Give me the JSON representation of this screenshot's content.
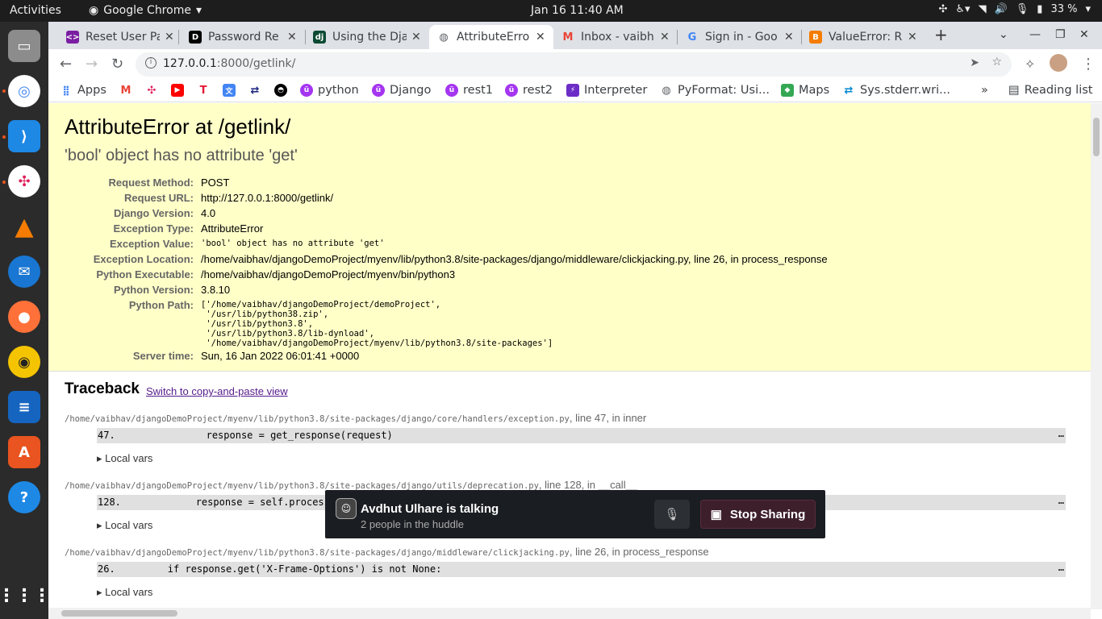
{
  "system": {
    "activities": "Activities",
    "app_name": "Google Chrome",
    "clock": "Jan 16  11:40 AM",
    "battery": "33 %"
  },
  "tabs": [
    {
      "title": "Reset User Pa",
      "icon": "code-arrows-icon",
      "color": "#7b1fa2"
    },
    {
      "title": "Password Re",
      "icon": "dev-icon",
      "color": "#000000"
    },
    {
      "title": "Using the Dja",
      "icon": "django-icon",
      "color": "#0c4b33"
    },
    {
      "title": "AttributeErro",
      "icon": "globe-icon",
      "color": "#5f6368"
    },
    {
      "title": "Inbox - vaibh",
      "icon": "gmail-icon",
      "color": "#ea4335"
    },
    {
      "title": "Sign in - Goo",
      "icon": "google-icon",
      "color": "#4285f4"
    },
    {
      "title": "ValueError: R",
      "icon": "blogger-icon",
      "color": "#f57c00"
    }
  ],
  "omnibox": {
    "host": "127.0.0.1",
    "path": ":8000/getlink/"
  },
  "bookmarks": [
    {
      "label": "Apps",
      "icon": "apps-grid-icon"
    },
    {
      "label": "",
      "icon": "gmail-icon"
    },
    {
      "label": "",
      "icon": "slack-icon"
    },
    {
      "label": "",
      "icon": "youtube-icon"
    },
    {
      "label": "",
      "icon": "tesla-icon"
    },
    {
      "label": "",
      "icon": "translate-icon"
    },
    {
      "label": "",
      "icon": "sync-icon"
    },
    {
      "label": "",
      "icon": "github-icon"
    },
    {
      "label": "python",
      "icon": "udemy-icon"
    },
    {
      "label": "Django",
      "icon": "udemy-icon"
    },
    {
      "label": "rest1",
      "icon": "udemy-icon"
    },
    {
      "label": "rest2",
      "icon": "udemy-icon"
    },
    {
      "label": "Interpreter",
      "icon": "bolt-icon"
    },
    {
      "label": "PyFormat: Usi...",
      "icon": "globe-icon"
    },
    {
      "label": "Maps",
      "icon": "maps-icon"
    },
    {
      "label": "Sys.stderr.wri...",
      "icon": "sync-icon"
    }
  ],
  "reading_list": "Reading list",
  "error": {
    "title": "AttributeError at /getlink/",
    "message": "'bool' object has no attribute 'get'",
    "meta": [
      {
        "key": "Request Method:",
        "value": "POST"
      },
      {
        "key": "Request URL:",
        "value": "http://127.0.0.1:8000/getlink/"
      },
      {
        "key": "Django Version:",
        "value": "4.0"
      },
      {
        "key": "Exception Type:",
        "value": "AttributeError"
      },
      {
        "key": "Exception Value:",
        "value": "'bool' object has no attribute 'get'"
      },
      {
        "key": "Exception Location:",
        "value": "/home/vaibhav/djangoDemoProject/myenv/lib/python3.8/site-packages/django/middleware/clickjacking.py, line 26, in process_response"
      },
      {
        "key": "Python Executable:",
        "value": "/home/vaibhav/djangoDemoProject/myenv/bin/python3"
      },
      {
        "key": "Python Version:",
        "value": "3.8.10"
      },
      {
        "key": "Python Path:",
        "value": "['/home/vaibhav/djangoDemoProject/demoProject',"
      },
      {
        "key": "Server time:",
        "value": "Sun, 16 Jan 2022 06:01:41 +0000"
      }
    ],
    "python_path_lines": [
      " '/usr/lib/python38.zip',",
      " '/usr/lib/python3.8',",
      " '/usr/lib/python3.8/lib-dynload',",
      " '/home/vaibhav/djangoDemoProject/myenv/lib/python3.8/site-packages']"
    ]
  },
  "traceback": {
    "heading": "Traceback",
    "switch_link": "Switch to copy-and-paste view",
    "frames": [
      {
        "path": "/home/vaibhav/djangoDemoProject/myenv/lib/python3.8/site-packages/django/core/handlers/exception.py",
        "suffix": ", line 47, in inner",
        "num": "47.",
        "code": "                response = get_response(request)",
        "local_vars": "Local vars"
      },
      {
        "path": "/home/vaibhav/djangoDemoProject/myenv/lib/python3.8/site-packages/django/utils/deprecation.py",
        "suffix": ", line 128, in __call__",
        "num": "128.",
        "code": "            response = self.process_response(request, response)",
        "local_vars": "Local vars"
      },
      {
        "path": "/home/vaibhav/djangoDemoProject/myenv/lib/python3.8/site-packages/django/middleware/clickjacking.py",
        "suffix": ", line 26, in process_response",
        "num": "26.",
        "code": "        if response.get('X-Frame-Options') is not None:",
        "local_vars": "Local vars"
      }
    ]
  },
  "huddle": {
    "name": "Avdhut Ulhare is talking",
    "sub": "2 people in the huddle",
    "stop_label": "Stop Sharing"
  }
}
